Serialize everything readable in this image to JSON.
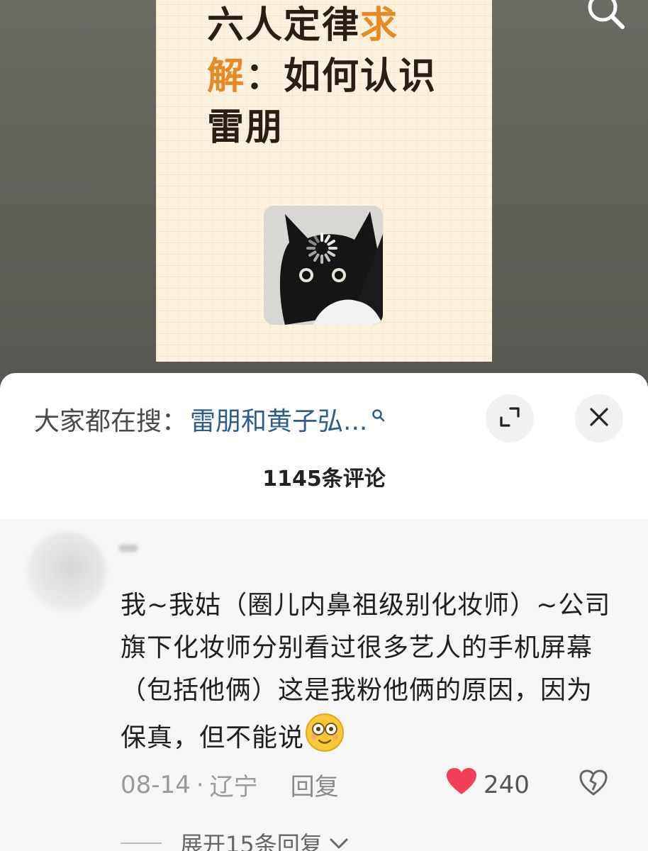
{
  "post": {
    "title_part1": "六人定律",
    "title_accent1": "求",
    "title_accent2": "解",
    "title_part2": "：如何认识雷朋"
  },
  "hot_search": {
    "label": "大家都在搜：",
    "term": "雷朋和黄子弘..."
  },
  "comments_header": {
    "count_label": "1145条评论"
  },
  "comment": {
    "text": "我~我姑（圈儿内鼻祖级别化妆师）~公司旗下化妆师分别看过很多艺人的手机屏幕（包括他俩）这是我粉他俩的原因，因为保真，但不能说",
    "date": "08-14",
    "separator": "·",
    "location": "辽宁",
    "reply_label": "回复",
    "like_count": "240",
    "expand_replies_label": "展开15条回复"
  },
  "icons": {
    "search": "search-icon",
    "expand": "expand-icon",
    "close": "close-icon",
    "heart": "heart-icon",
    "dislike": "broken-heart-icon",
    "chevron": "chevron-down-icon",
    "loading": "loading-spinner-icon"
  },
  "colors": {
    "accent_orange": "#e58a26",
    "link_blue": "#2b5d8f",
    "like_red": "#f2405a"
  }
}
